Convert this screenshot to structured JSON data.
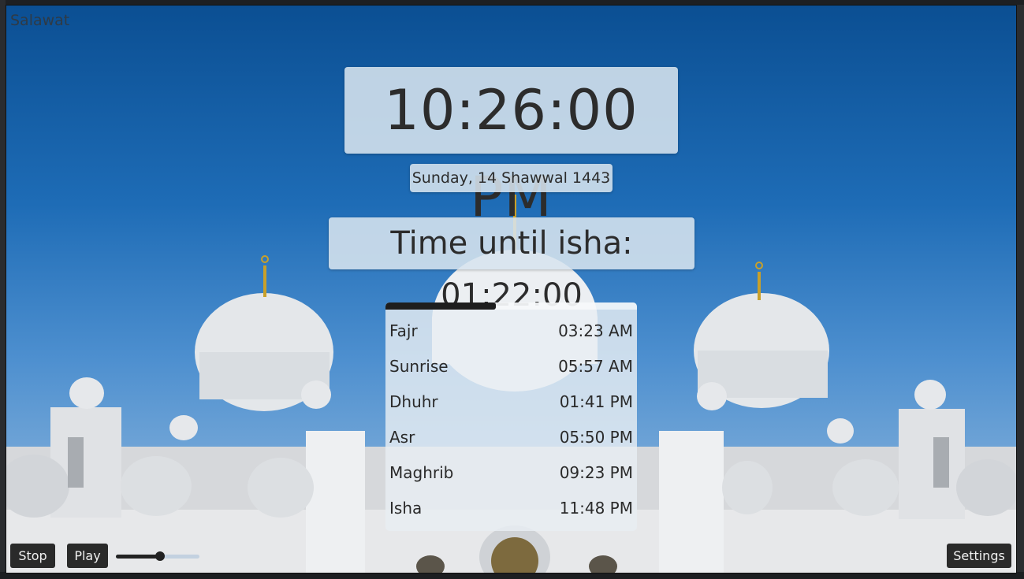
{
  "app": {
    "title": "Salawat"
  },
  "clock": {
    "time": "10:26:00 PM"
  },
  "date": {
    "hijri": "Sunday, 14 Shawwal 1443"
  },
  "countdown": {
    "text": "Time until isha: 01:22:00"
  },
  "progress": {
    "fraction": 0.44
  },
  "prayers": [
    {
      "name": "Fajr",
      "time": "03:23 AM"
    },
    {
      "name": "Sunrise",
      "time": "05:57 AM"
    },
    {
      "name": "Dhuhr",
      "time": "01:41 PM"
    },
    {
      "name": "Asr",
      "time": "05:50 PM"
    },
    {
      "name": "Maghrib",
      "time": "09:23 PM"
    },
    {
      "name": "Isha",
      "time": "11:48 PM"
    }
  ],
  "controls": {
    "stop_label": "Stop",
    "play_label": "Play",
    "settings_label": "Settings",
    "volume_fraction": 0.53
  },
  "colors": {
    "sky": "#1e6cb6",
    "card": "#d7e4ee",
    "button": "#2a2a2a"
  }
}
